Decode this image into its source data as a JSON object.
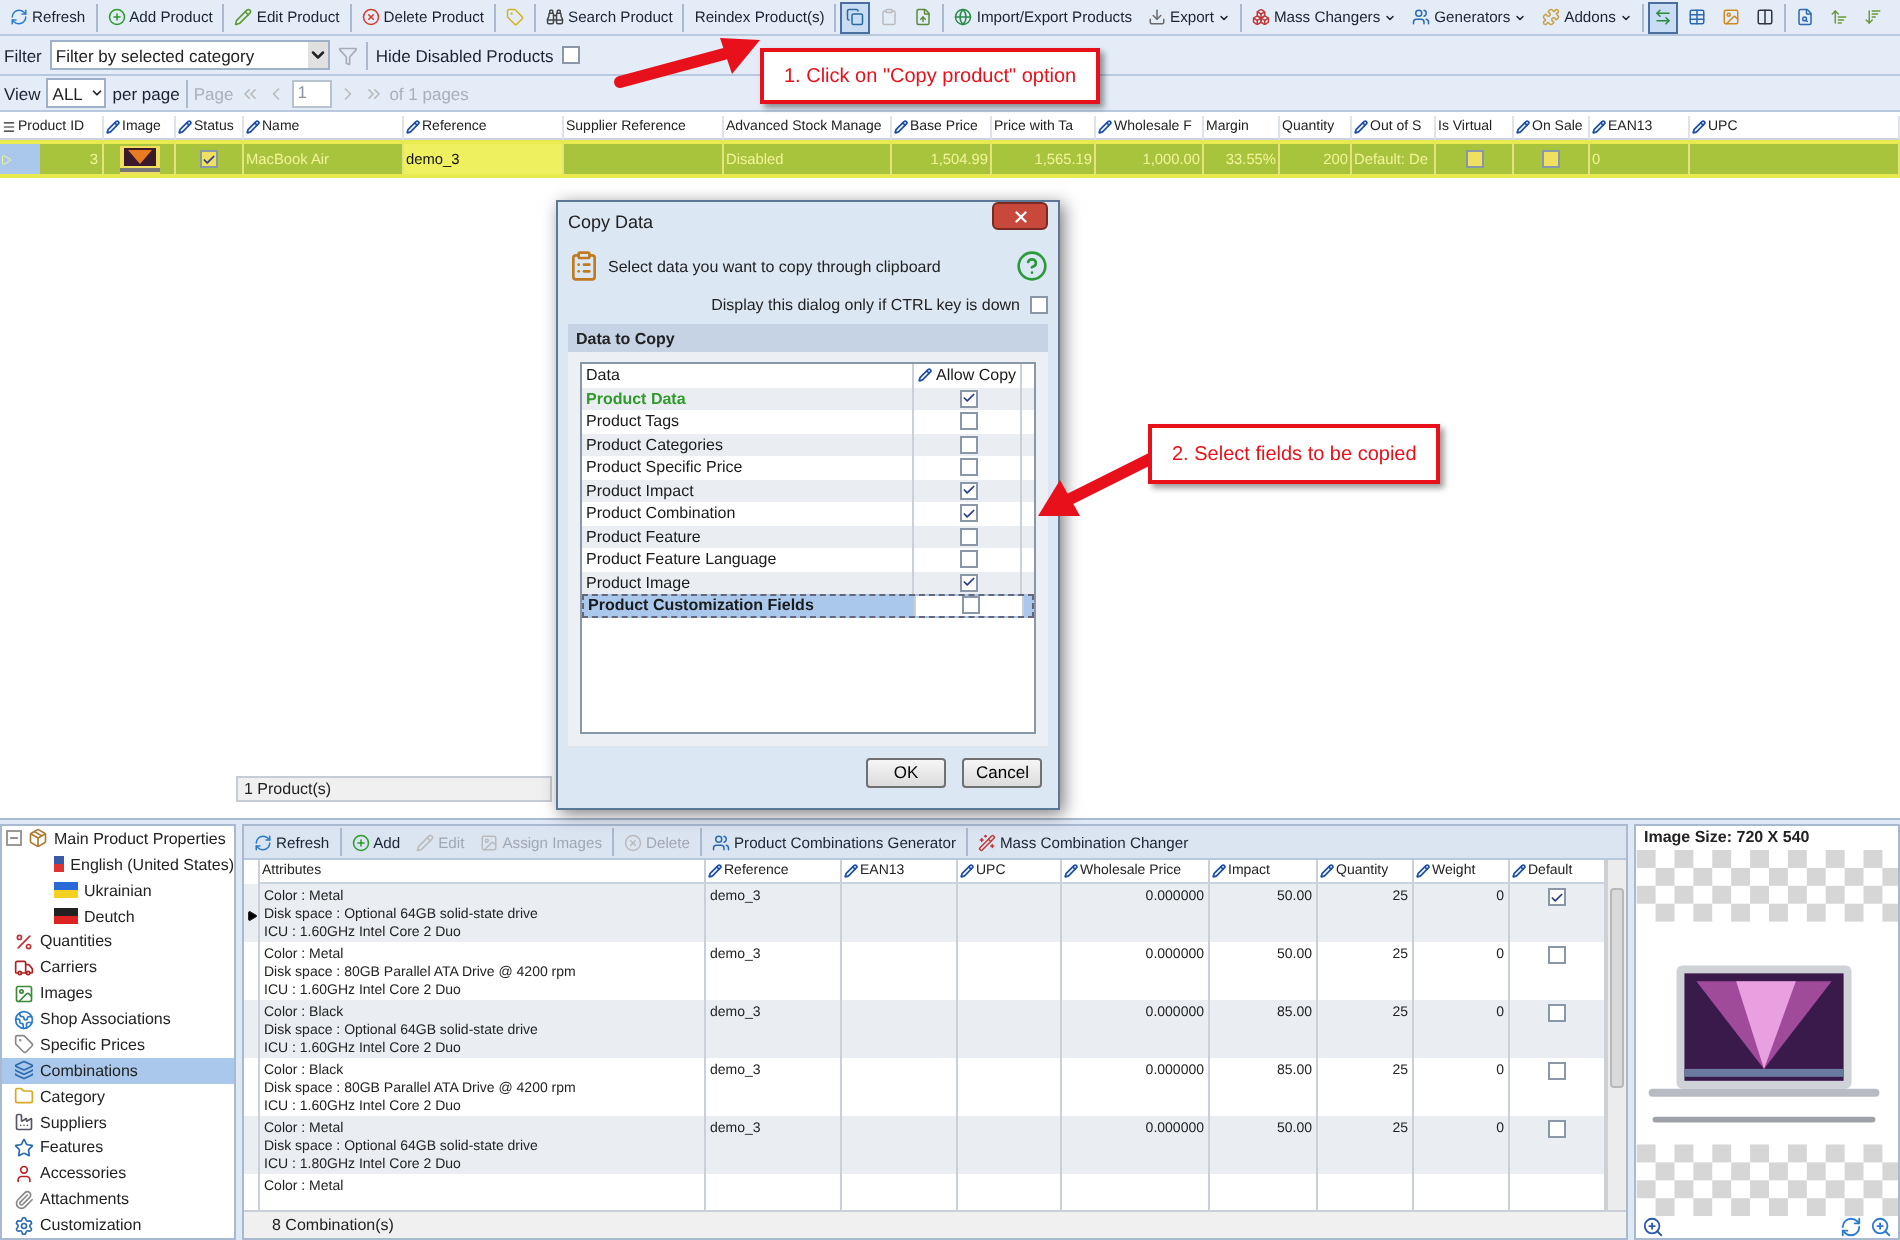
{
  "toolbar": {
    "items": [
      {
        "kind": "button",
        "label": "Refresh"
      },
      {
        "kind": "button",
        "label": "Add Product"
      },
      {
        "kind": "button",
        "label": "Edit Product"
      },
      {
        "kind": "button",
        "label": "Delete Product"
      },
      {
        "kind": "icon",
        "selected": false,
        "disabled": false
      },
      {
        "kind": "button",
        "label": "Search Product"
      },
      {
        "kind": "button",
        "label": "Reindex Product(s)"
      },
      {
        "kind": "icon",
        "selected": true,
        "disabled": false
      },
      {
        "kind": "icon",
        "selected": false,
        "disabled": true
      },
      {
        "kind": "icon",
        "selected": false,
        "disabled": false
      },
      {
        "kind": "button",
        "label": "Import/Export Products"
      },
      {
        "kind": "dropdown",
        "label": "Export"
      },
      {
        "kind": "dropdown",
        "label": "Mass Changers"
      },
      {
        "kind": "dropdown",
        "label": "Generators"
      },
      {
        "kind": "dropdown",
        "label": "Addons"
      },
      {
        "kind": "icon",
        "selected": true,
        "disabled": false
      },
      {
        "kind": "icon",
        "selected": false,
        "disabled": false
      },
      {
        "kind": "icon",
        "selected": false,
        "disabled": false
      },
      {
        "kind": "icon",
        "selected": false,
        "disabled": false
      },
      {
        "kind": "icon",
        "selected": false,
        "disabled": false
      },
      {
        "kind": "icon",
        "selected": false,
        "disabled": false
      },
      {
        "kind": "icon",
        "selected": false,
        "disabled": false
      }
    ]
  },
  "filter": {
    "label": "Filter",
    "value": "Filter by selected category",
    "hide_disabled": {
      "label": "Hide Disabled Products",
      "checked": false
    }
  },
  "pager": {
    "view_label": "View",
    "per_page_value": "ALL",
    "per_page_label": "per page",
    "page_label": "Page",
    "page_value": "1",
    "of_pages": "of 1 pages"
  },
  "annotations": [
    {
      "text": "1. Click on \"Copy product\" option"
    },
    {
      "text": "2. Select fields to be copied"
    }
  ],
  "products": {
    "columns": [
      {
        "label": "Product ID",
        "editable": false
      },
      {
        "label": "Image",
        "editable": true
      },
      {
        "label": "Status",
        "editable": true
      },
      {
        "label": "Name",
        "editable": true
      },
      {
        "label": "Reference",
        "editable": true
      },
      {
        "label": "Supplier Reference",
        "editable": false
      },
      {
        "label": "Advanced Stock Manage",
        "editable": false
      },
      {
        "label": "Base Price",
        "editable": true
      },
      {
        "label": "Price with Ta",
        "editable": false
      },
      {
        "label": "Wholesale F",
        "editable": true
      },
      {
        "label": "Margin",
        "editable": false
      },
      {
        "label": "Quantity",
        "editable": false
      },
      {
        "label": "Out of S",
        "editable": true
      },
      {
        "label": "Is Virtual",
        "editable": false
      },
      {
        "label": "On Sale",
        "editable": true
      },
      {
        "label": "EAN13",
        "editable": true
      },
      {
        "label": "UPC",
        "editable": true
      }
    ],
    "rows": [
      {
        "selected": true,
        "cells": [
          {
            "kind": "number",
            "text": "3",
            "focused": false
          },
          {
            "kind": "picture",
            "focused": false
          },
          {
            "kind": "check",
            "checked": true,
            "focused": false
          },
          {
            "kind": "text",
            "text": "MacBook Air",
            "focused": false
          },
          {
            "kind": "text",
            "text": "demo_3",
            "focused": true
          },
          {
            "kind": "text",
            "focused": false
          },
          {
            "kind": "text",
            "text": "Disabled",
            "focused": false
          },
          {
            "kind": "number",
            "text": "1,504.99",
            "focused": false
          },
          {
            "kind": "number",
            "text": "1,565.19",
            "focused": false
          },
          {
            "kind": "number",
            "text": "1,000.00",
            "focused": false
          },
          {
            "kind": "number",
            "text": "33.55%",
            "focused": false
          },
          {
            "kind": "number",
            "text": "200",
            "focused": false
          },
          {
            "kind": "text",
            "text": "Default: De",
            "focused": false
          },
          {
            "kind": "check",
            "checked": false,
            "focused": false
          },
          {
            "kind": "check",
            "checked": false,
            "focused": false
          },
          {
            "kind": "text",
            "text": "0",
            "focused": false
          },
          {
            "kind": "text",
            "focused": false
          }
        ]
      }
    ],
    "status": "1 Product(s)"
  },
  "dialog": {
    "title": "Copy Data",
    "message": "Select data you want to copy through clipboard",
    "ctrl_option": {
      "label": "Display this dialog only if CTRL key is down",
      "checked": false
    },
    "section": "Data to Copy",
    "columns": [
      "Data",
      "Allow Copy"
    ],
    "rows": [
      {
        "label": "Product Data",
        "primary": true,
        "selected": false,
        "allowed": true
      },
      {
        "label": "Product Tags",
        "primary": false,
        "selected": false,
        "allowed": false
      },
      {
        "label": "Product Categories",
        "primary": false,
        "selected": false,
        "allowed": false
      },
      {
        "label": "Product Specific Price",
        "primary": false,
        "selected": false,
        "allowed": false
      },
      {
        "label": "Product Impact",
        "primary": false,
        "selected": false,
        "allowed": true
      },
      {
        "label": "Product Combination",
        "primary": false,
        "selected": false,
        "allowed": true
      },
      {
        "label": "Product Feature",
        "primary": false,
        "selected": false,
        "allowed": false
      },
      {
        "label": "Product Feature Language",
        "primary": false,
        "selected": false,
        "allowed": false
      },
      {
        "label": "Product Image",
        "primary": false,
        "selected": false,
        "allowed": true
      },
      {
        "label": "Product Customization Fields",
        "primary": false,
        "selected": true,
        "allowed": false
      }
    ],
    "buttons": [
      "OK",
      "Cancel"
    ]
  },
  "sidebar": {
    "items": [
      {
        "label": "Main Product Properties",
        "selected": false,
        "expanded": true,
        "children": [
          {
            "label": "English (United States)",
            "selected": false
          },
          {
            "label": "Ukrainian",
            "selected": false
          },
          {
            "label": "Deutch",
            "selected": false
          }
        ]
      },
      {
        "label": "Quantities",
        "selected": false
      },
      {
        "label": "Carriers",
        "selected": false
      },
      {
        "label": "Images",
        "selected": false
      },
      {
        "label": "Shop Associations",
        "selected": false
      },
      {
        "label": "Specific Prices",
        "selected": false
      },
      {
        "label": "Combinations",
        "selected": true
      },
      {
        "label": "Category",
        "selected": false
      },
      {
        "label": "Suppliers",
        "selected": false
      },
      {
        "label": "Features",
        "selected": false
      },
      {
        "label": "Accessories",
        "selected": false
      },
      {
        "label": "Attachments",
        "selected": false
      },
      {
        "label": "Customization",
        "selected": false
      }
    ]
  },
  "combinations": {
    "toolbar": [
      {
        "label": "Refresh",
        "disabled": false
      },
      {
        "label": "Add",
        "disabled": false
      },
      {
        "label": "Edit",
        "disabled": true
      },
      {
        "label": "Assign Images",
        "disabled": true
      },
      {
        "label": "Delete",
        "disabled": true
      },
      {
        "label": "Product Combinations Generator",
        "disabled": false
      },
      {
        "label": "Mass Combination Changer",
        "disabled": false
      }
    ],
    "columns": [
      {
        "label": "Attributes",
        "editable": false
      },
      {
        "label": "Reference",
        "editable": true
      },
      {
        "label": "EAN13",
        "editable": true
      },
      {
        "label": "UPC",
        "editable": true
      },
      {
        "label": "Wholesale Price",
        "editable": true
      },
      {
        "label": "Impact",
        "editable": true
      },
      {
        "label": "Quantity",
        "editable": true
      },
      {
        "label": "Weight",
        "editable": true
      },
      {
        "label": "Default",
        "editable": true
      }
    ],
    "rows": [
      {
        "current": true,
        "attributes": [
          "Color : Metal",
          "Disk space : Optional 64GB solid-state drive",
          "ICU : 1.60GHz Intel Core 2 Duo"
        ],
        "reference": "demo_3",
        "wholesale_price": "0.000000",
        "impact": "50.00",
        "quantity": "25",
        "weight": "0",
        "default": true
      },
      {
        "current": false,
        "attributes": [
          "Color : Metal",
          "Disk space : 80GB Parallel ATA Drive @ 4200 rpm",
          "ICU : 1.60GHz Intel Core 2 Duo"
        ],
        "reference": "demo_3",
        "wholesale_price": "0.000000",
        "impact": "50.00",
        "quantity": "25",
        "weight": "0",
        "default": false
      },
      {
        "current": false,
        "attributes": [
          "Color : Black",
          "Disk space : Optional 64GB solid-state drive",
          "ICU : 1.60GHz Intel Core 2 Duo"
        ],
        "reference": "demo_3",
        "wholesale_price": "0.000000",
        "impact": "85.00",
        "quantity": "25",
        "weight": "0",
        "default": false
      },
      {
        "current": false,
        "attributes": [
          "Color : Black",
          "Disk space : 80GB Parallel ATA Drive @ 4200 rpm",
          "ICU : 1.60GHz Intel Core 2 Duo"
        ],
        "reference": "demo_3",
        "wholesale_price": "0.000000",
        "impact": "85.00",
        "quantity": "25",
        "weight": "0",
        "default": false
      },
      {
        "current": false,
        "attributes": [
          "Color : Metal",
          "Disk space : Optional 64GB solid-state drive",
          "ICU : 1.80GHz Intel Core 2 Duo"
        ],
        "reference": "demo_3",
        "wholesale_price": "0.000000",
        "impact": "50.00",
        "quantity": "25",
        "weight": "0",
        "default": false
      },
      {
        "current": false,
        "attributes": [
          "Color : Metal"
        ]
      }
    ],
    "status": "8 Combination(s)"
  },
  "image_panel": {
    "size_label": "Image Size: 720 X 540"
  }
}
